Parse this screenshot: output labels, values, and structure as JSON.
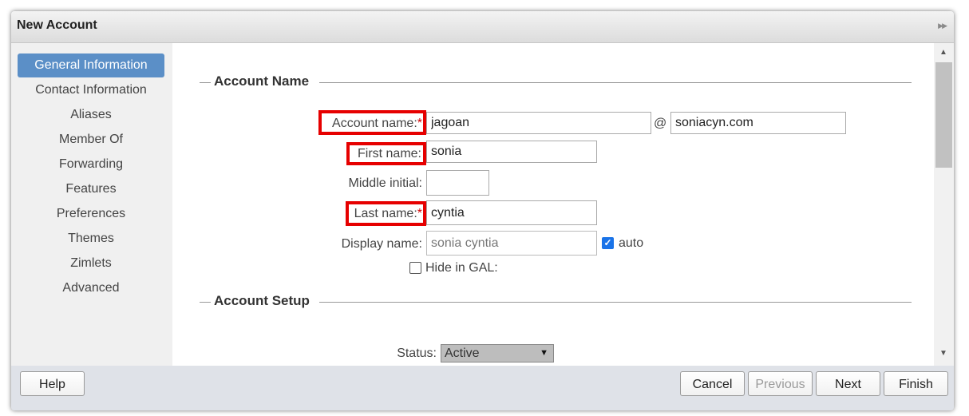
{
  "dialog": {
    "title": "New Account",
    "expand_icon": "double-chevron-right-icon"
  },
  "sidebar": {
    "items": [
      {
        "label": "General Information",
        "selected": true
      },
      {
        "label": "Contact Information"
      },
      {
        "label": "Aliases"
      },
      {
        "label": "Member Of"
      },
      {
        "label": "Forwarding"
      },
      {
        "label": "Features"
      },
      {
        "label": "Preferences"
      },
      {
        "label": "Themes"
      },
      {
        "label": "Zimlets"
      },
      {
        "label": "Advanced"
      }
    ],
    "selected_color": "#5b8fc7"
  },
  "account_name_section": {
    "title": "Account Name",
    "account_name": {
      "label": "Account name:",
      "required_mark": "*",
      "value": "jagoan"
    },
    "at_sign": "@",
    "domain": {
      "value": "soniacyn.com"
    },
    "first_name": {
      "label": "First name:",
      "value": "sonia"
    },
    "middle_initial": {
      "label": "Middle initial:",
      "value": ""
    },
    "last_name": {
      "label": "Last name:",
      "required_mark": "*",
      "value": "cyntia"
    },
    "display_name": {
      "label": "Display name:",
      "value": "sonia cyntia"
    },
    "auto": {
      "label": "auto",
      "checked": true
    },
    "hide_in_gal": {
      "label": "Hide in GAL:",
      "checked": false
    }
  },
  "account_setup_section": {
    "title": "Account Setup",
    "status": {
      "label": "Status:",
      "value": "Active"
    }
  },
  "footer": {
    "help": "Help",
    "cancel": "Cancel",
    "previous": "Previous",
    "next": "Next",
    "finish": "Finish"
  },
  "highlight_color": "#e60000"
}
